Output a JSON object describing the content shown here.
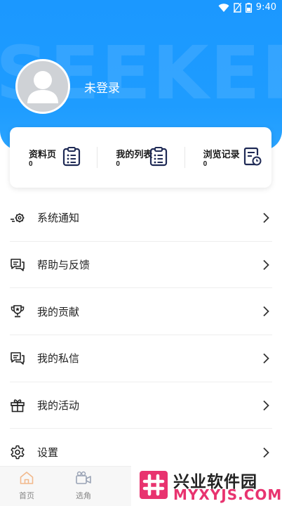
{
  "status_bar": {
    "time": "9:40"
  },
  "header": {
    "watermark": "SEEKER",
    "login_label": "未登录"
  },
  "stats": [
    {
      "label": "资料页",
      "count": "0",
      "icon": "clipboard-list-icon"
    },
    {
      "label": "我的列表",
      "count": "0",
      "icon": "clipboard-list-icon"
    },
    {
      "label": "浏览记录",
      "count": "0",
      "icon": "history-document-icon"
    }
  ],
  "menu": [
    {
      "label": "系统通知",
      "icon": "gear-notify-icon"
    },
    {
      "label": "帮助与反馈",
      "icon": "chat-bubbles-icon"
    },
    {
      "label": "我的贡献",
      "icon": "trophy-icon"
    },
    {
      "label": "我的私信",
      "icon": "message-icon"
    },
    {
      "label": "我的活动",
      "icon": "gift-icon"
    },
    {
      "label": "设置",
      "icon": "gear-icon"
    }
  ],
  "tabbar": [
    {
      "label": "首页",
      "icon": "home-icon"
    },
    {
      "label": "选角",
      "icon": "camera-icon"
    }
  ],
  "brand": {
    "name": "兴业软件园",
    "url": "MYXYJS.COM",
    "mark_color": "#e8336f"
  },
  "colors": {
    "header_blue": "#1e9cff",
    "icon_navy": "#1f2a55"
  }
}
